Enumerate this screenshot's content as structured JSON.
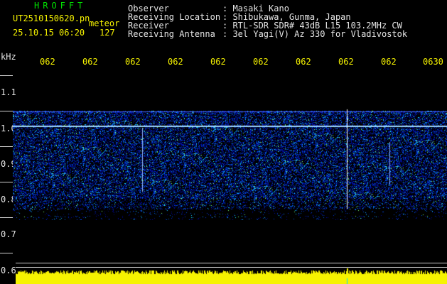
{
  "header": {
    "station_name": "HROFFT",
    "file_name": "UT2510150620.pn",
    "mode": "meteor",
    "date_time": "25.10.15 06:20",
    "count": "127",
    "fields": [
      {
        "label": "Observer",
        "value": ": Masaki Kano"
      },
      {
        "label": "Receiving Location",
        "value": ": Shibukawa, Gunma, Japan"
      },
      {
        "label": "Receiver",
        "value": ": RTL-SDR SDR# 43dB L15 103.2MHz CW"
      },
      {
        "label": "Receiving Antenna",
        "value": ": 3el Yagi(V) Az 330 for Vladivostok"
      }
    ]
  },
  "axis": {
    "unit": "kHz",
    "y_ticks": [
      "1.1",
      "1.0",
      "0.9",
      "0.8",
      "0.7",
      "0.6"
    ],
    "x_ticks": [
      "062",
      "062",
      "062",
      "062",
      "062",
      "062",
      "062",
      "062",
      "062",
      "0630"
    ]
  },
  "colors": {
    "background": "#000000",
    "header_text": "#e6e6e6",
    "time_labels": "#f6f300",
    "station_name": "#00e000",
    "signal_band": "#1a3cff",
    "carrier_line": "#ffffff",
    "waveform": "#f6f300"
  }
}
